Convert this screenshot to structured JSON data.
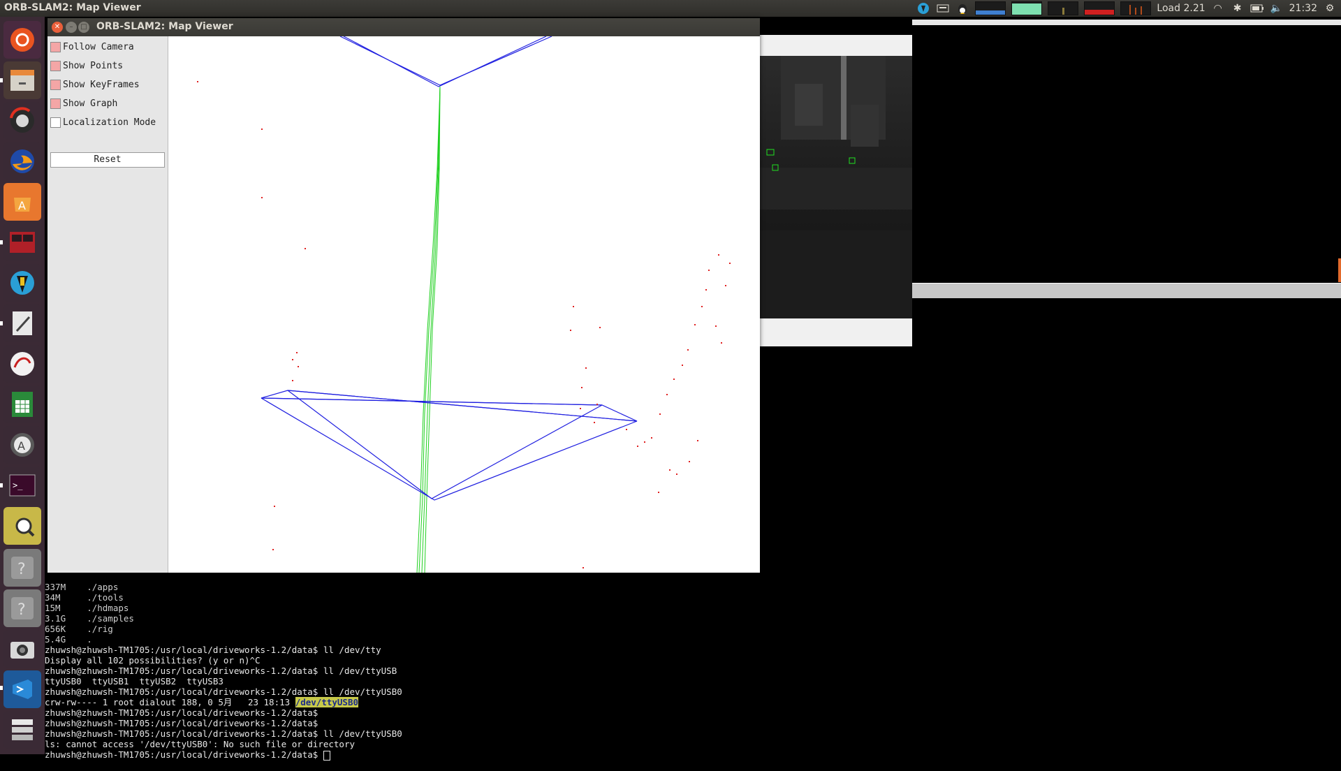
{
  "top_panel": {
    "title": "ORB-SLAM2: Map Viewer",
    "load": "Load 2.21",
    "clock": "21:32",
    "icons": [
      "vpn-icon",
      "keyboard-icon",
      "tux-icon",
      "wifi-icon",
      "bluetooth-icon",
      "battery-icon",
      "volume-icon",
      "settings-gear-icon"
    ]
  },
  "launcher": {
    "items": [
      "ubuntu-dash-icon",
      "file-manager-icon",
      "disk-icon",
      "firefox-icon",
      "software-center-icon",
      "remote-desktop-icon",
      "vpn-app-icon",
      "text-editor-icon",
      "document-viewer-icon",
      "spreadsheet-icon",
      "software-updater-icon",
      "terminal-icon",
      "image-viewer-icon",
      "unknown-app-icon",
      "unknown-app-icon",
      "camera-icon",
      "vscode-icon",
      "workspace-icon"
    ]
  },
  "map_viewer": {
    "title": "ORB-SLAM2: Map Viewer",
    "options": [
      {
        "label": "Follow Camera",
        "checked": true
      },
      {
        "label": "Show Points",
        "checked": true
      },
      {
        "label": "Show KeyFrames",
        "checked": true
      },
      {
        "label": "Show Graph",
        "checked": true
      },
      {
        "label": "Localization Mode",
        "checked": false
      }
    ],
    "reset_label": "Reset"
  },
  "terminal": {
    "lines": [
      "337M    ./apps",
      "34M     ./tools",
      "15M     ./hdmaps",
      "3.1G    ./samples",
      "656K    ./rig",
      "5.4G    .",
      "zhuwsh@zhuwsh-TM1705:/usr/local/driveworks-1.2/data$ ll /dev/tty",
      "Display all 102 possibilities? (y or n)^C",
      "zhuwsh@zhuwsh-TM1705:/usr/local/driveworks-1.2/data$ ll /dev/ttyUSB",
      "ttyUSB0  ttyUSB1  ttyUSB2  ttyUSB3",
      "zhuwsh@zhuwsh-TM1705:/usr/local/driveworks-1.2/data$ ll /dev/ttyUSB0"
    ],
    "crw_line_prefix": "crw-rw---- 1 root dialout 188, 0 5月   23 18:13 ",
    "crw_line_highlight": "/dev/ttyUSB0",
    "lines_after": [
      "zhuwsh@zhuwsh-TM1705:/usr/local/driveworks-1.2/data$",
      "zhuwsh@zhuwsh-TM1705:/usr/local/driveworks-1.2/data$",
      "zhuwsh@zhuwsh-TM1705:/usr/local/driveworks-1.2/data$ ll /dev/ttyUSB0",
      "ls: cannot access '/dev/ttyUSB0': No such file or directory"
    ],
    "prompt": "zhuwsh@zhuwsh-TM1705:/usr/local/driveworks-1.2/data$ "
  },
  "colors": {
    "keyframe": "#2020e0",
    "trajectory": "#20d020",
    "points": "#e02020",
    "feature_box": "#20e020"
  }
}
